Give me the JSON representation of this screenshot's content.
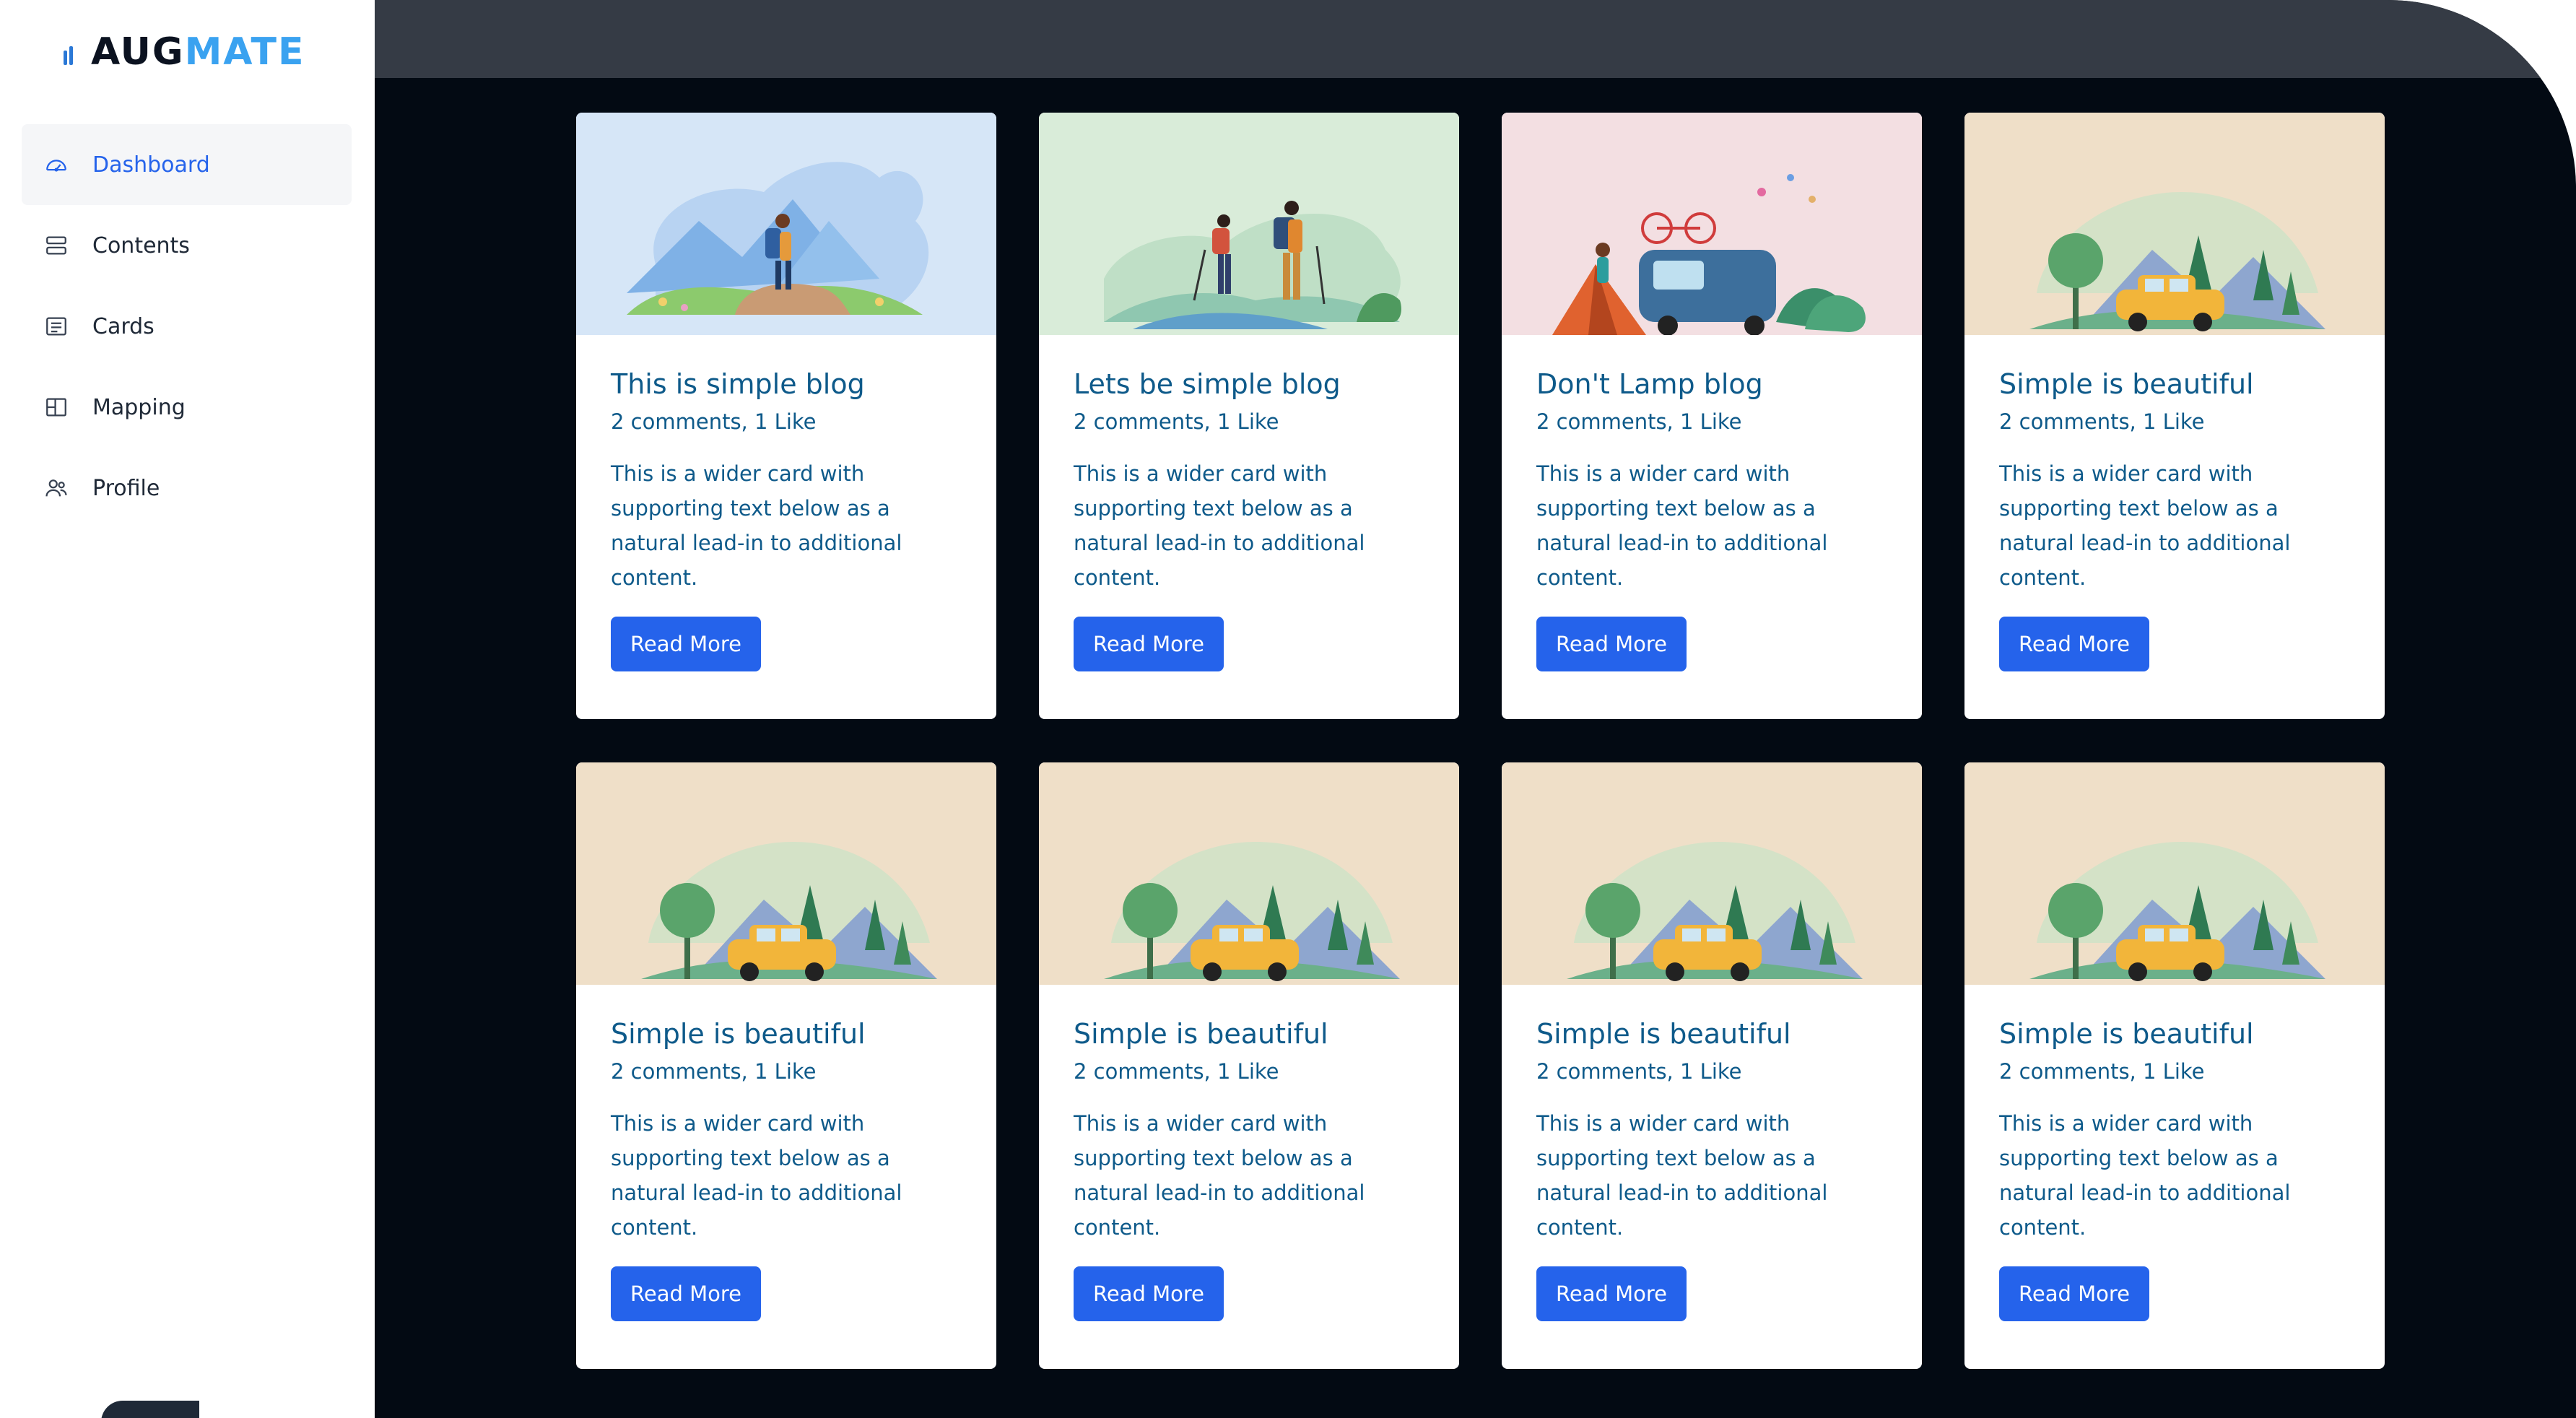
{
  "brand": {
    "part1": "AUG",
    "part2": "MATE"
  },
  "sidebar": {
    "items": [
      {
        "label": "Dashboard",
        "icon": "dashboard-icon",
        "active": true
      },
      {
        "label": "Contents",
        "icon": "contents-icon",
        "active": false
      },
      {
        "label": "Cards",
        "icon": "cards-icon",
        "active": false
      },
      {
        "label": "Mapping",
        "icon": "mapping-icon",
        "active": false
      },
      {
        "label": "Profile",
        "icon": "profile-icon",
        "active": false
      }
    ]
  },
  "colors": {
    "accent": "#2563eb",
    "text_blue": "#0e5a8a",
    "main_bg": "#030a13",
    "topbar": "#353b45"
  },
  "cards": [
    {
      "title": "This is simple blog",
      "meta": "2 comments, 1 Like",
      "text": "This is a wider card with supporting text below as a natural lead-in to additional content.",
      "button": "Read More",
      "image": "hiker-illustration",
      "bg": "#d6e6f7"
    },
    {
      "title": "Lets be simple blog",
      "meta": "2 comments, 1 Like",
      "text": "This is a wider card with supporting text below as a natural lead-in to additional content.",
      "button": "Read More",
      "image": "couple-hiking-illustration",
      "bg": "#d9ecd9"
    },
    {
      "title": "Don't Lamp blog",
      "meta": "2 comments, 1 Like",
      "text": "This is a wider card with supporting text below as a natural lead-in to additional content.",
      "button": "Read More",
      "image": "camping-illustration",
      "bg": "#f3dfe2"
    },
    {
      "title": "Simple is beautiful",
      "meta": "2 comments, 1 Like",
      "text": "This is a wider card with supporting text below as a natural lead-in to additional content.",
      "button": "Read More",
      "image": "road-trip-illustration",
      "bg": "#efdfc8"
    },
    {
      "title": "Simple is beautiful",
      "meta": "2 comments, 1 Like",
      "text": "This is a wider card with supporting text below as a natural lead-in to additional content.",
      "button": "Read More",
      "image": "road-trip-illustration",
      "bg": "#efdfc8"
    },
    {
      "title": "Simple is beautiful",
      "meta": "2 comments, 1 Like",
      "text": "This is a wider card with supporting text below as a natural lead-in to additional content.",
      "button": "Read More",
      "image": "road-trip-illustration",
      "bg": "#efdfc8"
    },
    {
      "title": "Simple is beautiful",
      "meta": "2 comments, 1 Like",
      "text": "This is a wider card with supporting text below as a natural lead-in to additional content.",
      "button": "Read More",
      "image": "road-trip-illustration",
      "bg": "#efdfc8"
    },
    {
      "title": "Simple is beautiful",
      "meta": "2 comments, 1 Like",
      "text": "This is a wider card with supporting text below as a natural lead-in to additional content.",
      "button": "Read More",
      "image": "road-trip-illustration",
      "bg": "#efdfc8"
    }
  ]
}
